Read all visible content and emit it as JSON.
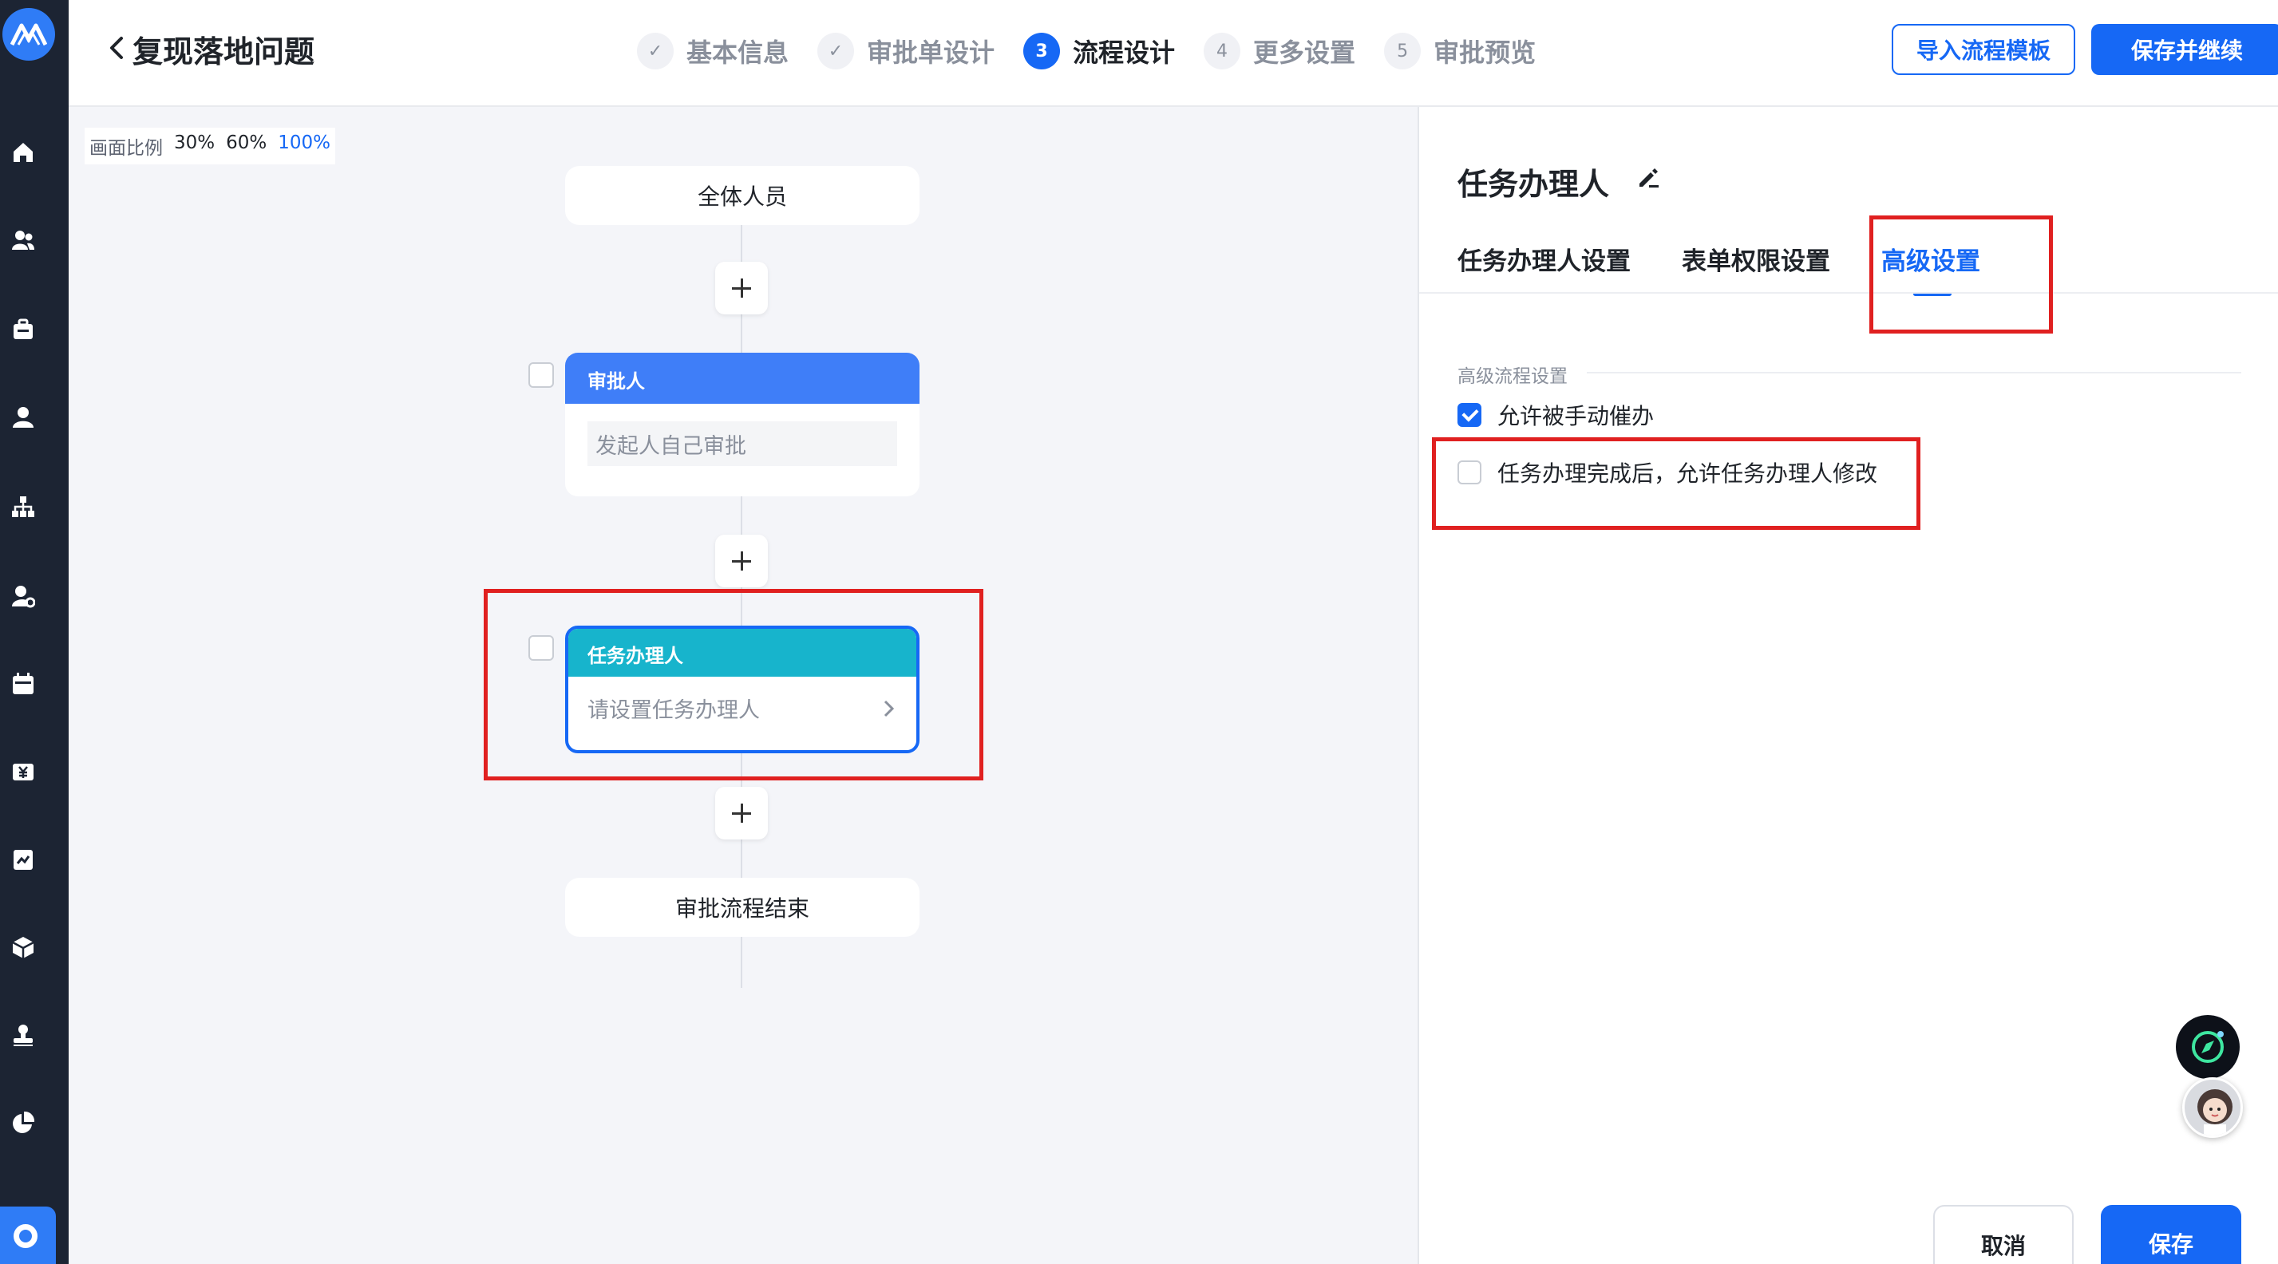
{
  "header": {
    "title": "复现落地问题",
    "steps": [
      {
        "num": "✓",
        "label": "基本信息"
      },
      {
        "num": "✓",
        "label": "审批单设计"
      },
      {
        "num": "3",
        "label": "流程设计"
      },
      {
        "num": "4",
        "label": "更多设置"
      },
      {
        "num": "5",
        "label": "审批预览"
      }
    ],
    "active_step": 2,
    "import_label": "导入流程模板",
    "save_continue_label": "保存并继续"
  },
  "canvas": {
    "zoom_label": "画面比例",
    "zoom_options": [
      "30%",
      "60%",
      "100%"
    ],
    "zoom_selected": "100%",
    "start_node": "全体人员",
    "approver_node": {
      "title": "审批人",
      "value": "发起人自己审批"
    },
    "task_node": {
      "title": "任务办理人",
      "placeholder": "请设置任务办理人"
    },
    "end_node": "审批流程结束"
  },
  "panel": {
    "title": "任务办理人",
    "tabs": [
      "任务办理人设置",
      "表单权限设置",
      "高级设置"
    ],
    "active_tab": 2,
    "section_label": "高级流程设置",
    "options": [
      {
        "label": "允许被手动催办",
        "checked": true
      },
      {
        "label": "任务办理完成后，允许任务办理人修改",
        "checked": false
      }
    ],
    "cancel_label": "取消",
    "save_label": "保存"
  },
  "colors": {
    "accent": "#1668f5",
    "rail": "#1c2433",
    "approver_header": "#3f7ef8",
    "task_header": "#17b4cc",
    "highlight": "#e02020"
  },
  "icons": {
    "rail": [
      "home-icon",
      "users-icon",
      "briefcase-icon",
      "user-icon",
      "org-chart-icon",
      "user-settings-icon",
      "calendar-icon",
      "finance-icon",
      "report-icon",
      "package-icon",
      "stamp-icon",
      "pie-chart-icon",
      "settings-circle-icon"
    ]
  }
}
